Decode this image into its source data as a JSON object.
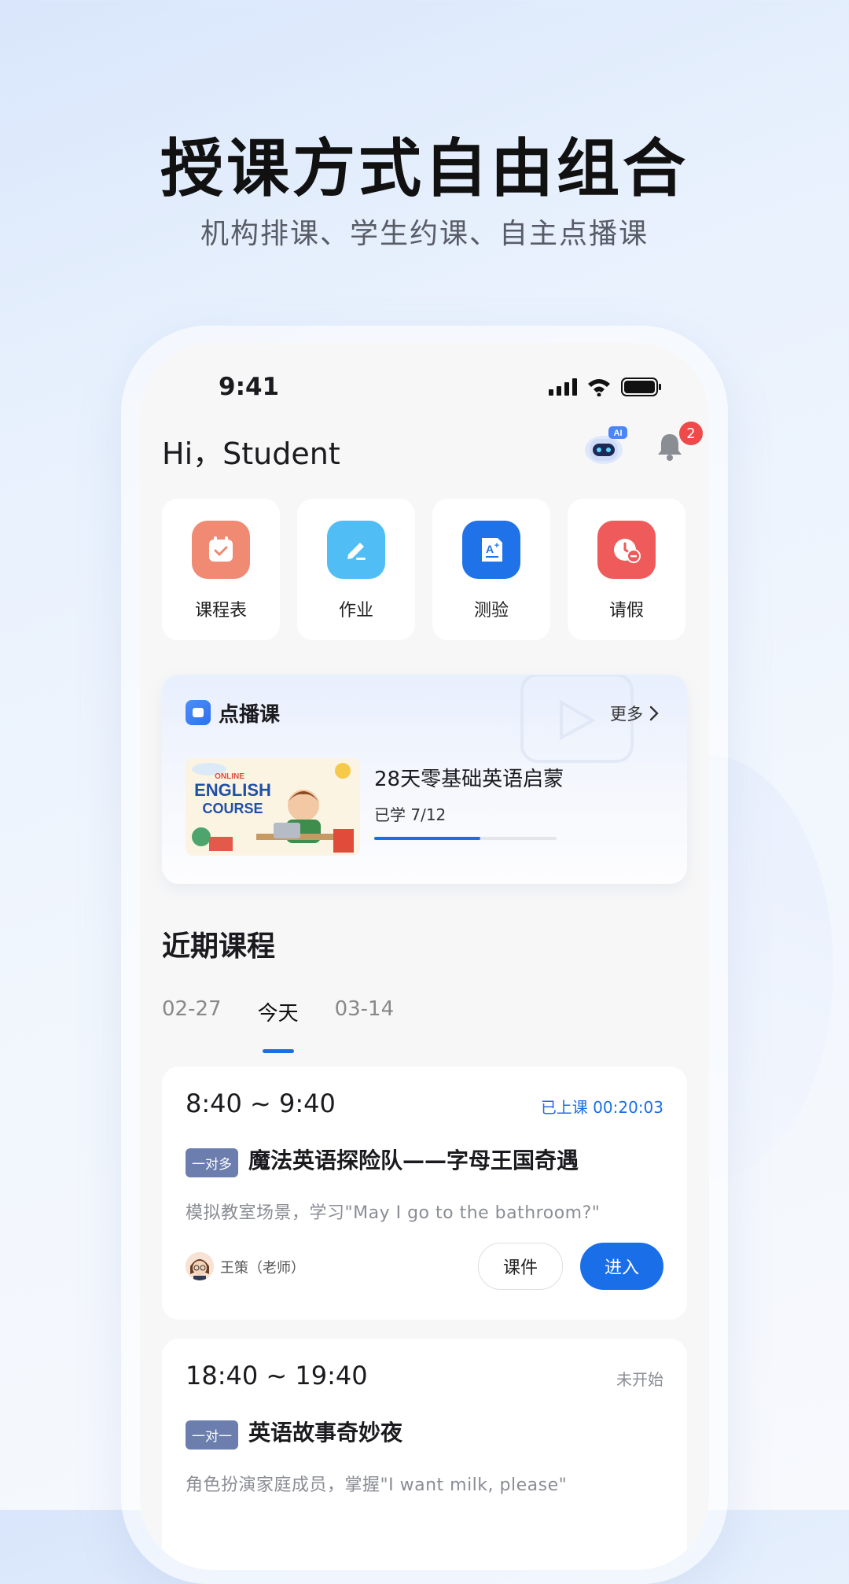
{
  "promo": {
    "title": "授课方式自由组合",
    "subtitle": "机构排课、学生约课、自主点播课"
  },
  "status_bar": {
    "time": "9:41"
  },
  "header": {
    "greeting": "Hi，Student",
    "robot_badge": "AI",
    "notification_count": "2"
  },
  "quick_actions": [
    {
      "label": "课程表",
      "icon": "calendar-check-icon",
      "color": "#f08a73"
    },
    {
      "label": "作业",
      "icon": "pen-edit-icon",
      "color": "#50bdf5"
    },
    {
      "label": "测验",
      "icon": "quiz-grade-icon",
      "color": "#1f72e8"
    },
    {
      "label": "请假",
      "icon": "clock-leave-icon",
      "color": "#ef5a5a"
    }
  ],
  "vod": {
    "title": "点播课",
    "more": "更多",
    "course": {
      "name": "28天零基础英语启蒙",
      "progress_text": "已学 7/12",
      "progress_fraction": 0.583,
      "thumb_lines": [
        "ONLINE",
        "ENGLISH",
        "COURSE"
      ]
    }
  },
  "recent": {
    "title": "近期课程",
    "tabs": [
      "02-27",
      "今天",
      "03-14"
    ],
    "lessons": [
      {
        "time": "8:40 ~ 9:40",
        "status": "已上课 00:20:03",
        "status_color": "#1a6fe8",
        "type": "一对多",
        "name": "魔法英语探险队——字母王国奇遇",
        "desc": "模拟教室场景，学习\"May I go to the bathroom?\"",
        "teacher": "王策（老师）",
        "btn_courseware": "课件",
        "btn_enter": "进入"
      },
      {
        "time": "18:40 ~ 19:40",
        "status": "未开始",
        "status_color": "#8a8d94",
        "type": "一对一",
        "name": "英语故事奇妙夜",
        "desc": "角色扮演家庭成员，掌握\"I want milk, please\""
      }
    ]
  }
}
